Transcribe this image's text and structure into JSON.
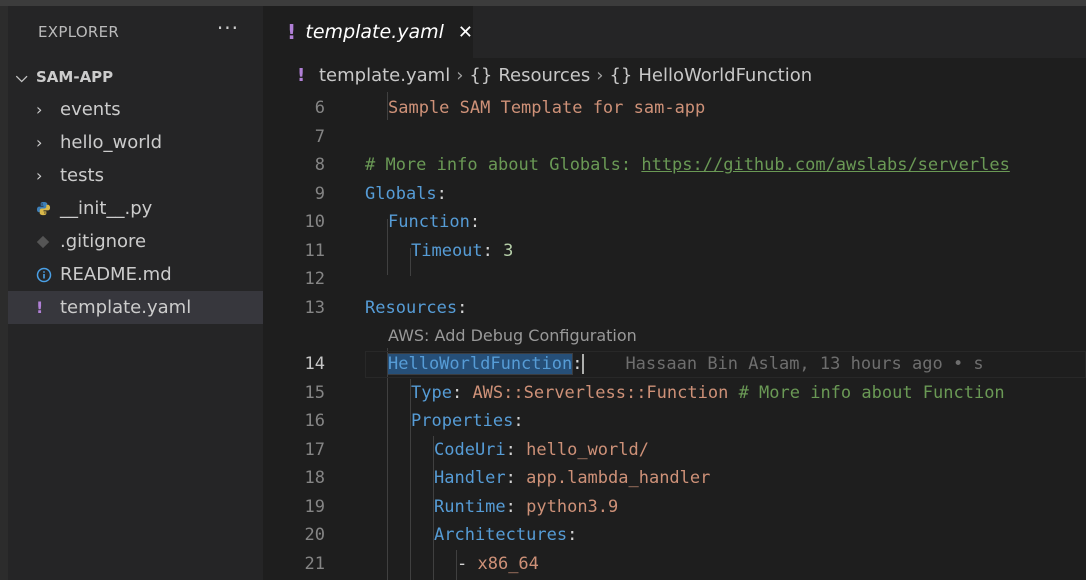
{
  "sidebar": {
    "title": "EXPLORER",
    "more": "···",
    "root": "SAM-APP",
    "items": [
      {
        "label": "events",
        "icon": "chevron-right-icon"
      },
      {
        "label": "hello_world",
        "icon": "chevron-right-icon"
      },
      {
        "label": "tests",
        "icon": "chevron-right-icon"
      },
      {
        "label": "__init__.py",
        "icon": "python-icon"
      },
      {
        "label": ".gitignore",
        "icon": "git-icon"
      },
      {
        "label": "README.md",
        "icon": "info-icon"
      },
      {
        "label": "template.yaml",
        "icon": "yaml-exclamation-icon",
        "selected": true
      }
    ]
  },
  "tab": {
    "label": "template.yaml",
    "close": "✕"
  },
  "breadcrumb": {
    "file": "template.yaml",
    "crumb1": "Resources",
    "crumb2": "HelloWorldFunction"
  },
  "editor": {
    "codelens": "AWS: Add Debug Configuration",
    "lines": [
      {
        "n": "6",
        "t": "Sample SAM Template for sam-app"
      },
      {
        "n": "7",
        "t": ""
      },
      {
        "n": "8",
        "t": "# More info about Globals: https://github.com/awslabs/serverles"
      },
      {
        "n": "9",
        "t": "Globals:"
      },
      {
        "n": "10",
        "t": "Function:"
      },
      {
        "n": "11",
        "t": "Timeout: 3"
      },
      {
        "n": "12",
        "t": ""
      },
      {
        "n": "13",
        "t": "Resources:"
      },
      {
        "n": "14",
        "t": "HelloWorldFunction:"
      },
      {
        "n": "15",
        "t": "Type: AWS::Serverless::Function # More info about Function"
      },
      {
        "n": "16",
        "t": "Properties:"
      },
      {
        "n": "17",
        "t": "CodeUri: hello_world/"
      },
      {
        "n": "18",
        "t": "Handler: app.lambda_handler"
      },
      {
        "n": "19",
        "t": "Runtime: python3.9"
      },
      {
        "n": "20",
        "t": "Architectures:"
      },
      {
        "n": "21",
        "t": "- x86_64"
      }
    ],
    "tokens": {
      "l6_s": "Sample SAM Template for sam-app",
      "l8_c": "# More info about Globals: ",
      "l8_url": "https://github.com/awslabs/serverles",
      "l9_k": "Globals",
      "l10_k": "Function",
      "l11_k": "Timeout",
      "l11_v": "3",
      "l13_k": "Resources",
      "l14_k": "HelloWorldFunction",
      "l14_blame": "Hassaan Bin Aslam, 13 hours ago • s",
      "l15_k": "Type",
      "l15_v": "AWS::Serverless::Function",
      "l15_c": "# More info about Function",
      "l16_k": "Properties",
      "l17_k": "CodeUri",
      "l17_v": "hello_world/",
      "l18_k": "Handler",
      "l18_v": "app.lambda_handler",
      "l19_k": "Runtime",
      "l19_v": "python3.9",
      "l20_k": "Architectures",
      "l21_v": "x86_64"
    }
  },
  "colors": {
    "keyword": "#569cd6",
    "string": "#ce9178",
    "comment": "#6a9955",
    "number": "#b5cea8",
    "yaml_icon": "#b180d7"
  }
}
